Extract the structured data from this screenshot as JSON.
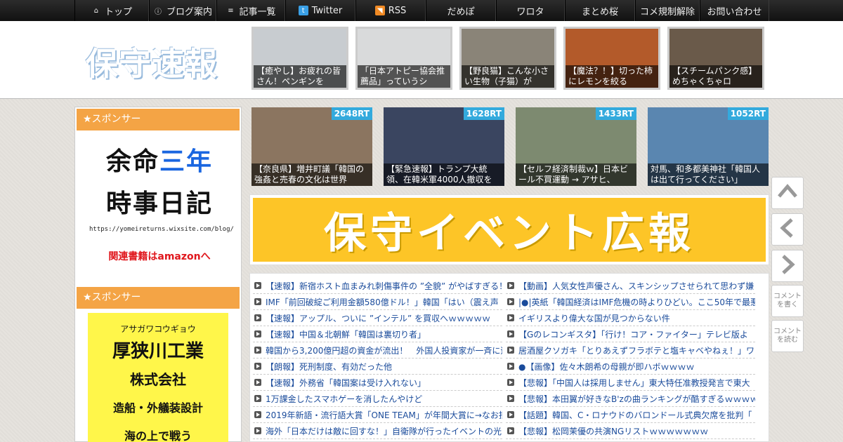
{
  "nav": [
    {
      "icon": "home-icon",
      "label": "トップ",
      "w": 106
    },
    {
      "icon": "info-icon",
      "label": "ブログ案内",
      "w": 96
    },
    {
      "icon": "list-icon",
      "label": "記事一覧",
      "w": 98
    },
    {
      "icon": "twitter-icon",
      "label": "Twitter",
      "w": 100
    },
    {
      "icon": "rss-icon",
      "label": "RSS",
      "w": 100
    },
    {
      "icon": "",
      "label": "だめぽ",
      "w": 100
    },
    {
      "icon": "",
      "label": "ワロタ",
      "w": 98
    },
    {
      "icon": "",
      "label": "まとめ桜",
      "w": 100
    },
    {
      "icon": "",
      "label": "コメ規制解除",
      "w": 92
    },
    {
      "icon": "",
      "label": "お問い合わせ",
      "w": 99
    }
  ],
  "logo": "保守速報",
  "featured": [
    {
      "caption": "【癒やし】お疲れの皆さん！ペンギンを",
      "bg": "#c8ccd0"
    },
    {
      "caption": "「日本アトピー協会推薦品」っていうシ",
      "bg": "#d9dadb"
    },
    {
      "caption": "【野良猫】こんな小さい生物（子猫）が",
      "bg": "#8a8478"
    },
    {
      "caption": "【魔法？！】切った柿にレモンを絞る",
      "bg": "#b35a2a"
    },
    {
      "caption": "【スチームパンク感】めちゃくちゃロ",
      "bg": "#6a5a4a"
    }
  ],
  "sidebar": {
    "heading1": "★スポンサー",
    "heading2": "★スポンサー",
    "ad1": {
      "line1a": "余命",
      "line1b": "三年",
      "line2": "時事日記",
      "url": "https://yomeireturns.wixsite.com/blog/",
      "amazon": "関連書籍はamazonへ"
    },
    "ad2": {
      "kana": "アサガワコウギョウ",
      "name": "厚狭川工業",
      "corp": "株式会社",
      "desc": "造船・外艤装設計",
      "last": "海の上で戦う"
    }
  },
  "rt": [
    {
      "count": "2648RT",
      "caption": "【奈良県】増井町議「韓国の強姦と売春の文化は世界",
      "bg": "#8b7560"
    },
    {
      "count": "1628RT",
      "caption": "【緊急速報】トランプ大統領、在韓米軍4000人撤収を",
      "bg": "#3a4560"
    },
    {
      "count": "1433RT",
      "caption": "【セルフ経済制裁ｗ】日本ビール不買運動 → アサヒ、",
      "bg": "#7d8a70"
    },
    {
      "count": "1052RT",
      "caption": "対馬、和多都美神社「韓国人は出て行ってください」",
      "bg": "#5a86b0"
    }
  ],
  "banner": "保守イベント広報",
  "news_left": [
    "【速報】新宿ホスト血まみれ刺傷事件の ”全貌” がやばすぎる！",
    "IMF「前回破綻ご利用金額580億ドル！」韓国「はい（震え声",
    "【速報】アップル、ついに ”インテル” を買収へｗｗｗｗｗ",
    "【速報】中国＆北朝鮮「韓国は裏切り者」",
    "韓国から3,200億円超の資金が流出！　外国人投資家が一斉に逃",
    "【朗報】死刑制度、有効だった他",
    "【速報】外務省「韓国案は受け入れない」",
    "1万課金したスマホゲーを消したんやけど",
    "2019年新語・流行語大賞「ONE TEAM」が年間大賞に→なお批",
    "海外「日本だけは敵に回すな！」自衛隊が行ったイベントの光"
  ],
  "news_right": [
    "【動画】人気女性声優さん、スキンシップさせられて思わず嫌",
    "|●|英紙「韓国経済はIMF危機の時よりひどい。ここ50年で最悪",
    "イギリスより偉大な国が見つからない件",
    "【Gのレコンギスタ】「行け！コア・ファイター」テレビ版よ",
    "居酒屋クソガキ「とりあえずフラボテと塩キャベやねぇ！」ワ",
    "●【画像】佐々木朗希の母親が即ハボｗｗｗｗ",
    "【悲報】「中国人は採用しません」東大特任准教授発言で東大",
    "【悲報】本田翼が好きなB'zの曲ランキングが酷すぎるｗｗｗｗ",
    "【話題】韓国、C・ロナウドのバロンドール式典欠席を批判「",
    "【悲報】松岡茉優の共演NGリストｗｗｗｗｗｗｗ"
  ],
  "side_buttons": [
    {
      "icon": "arrow-up-icon",
      "label": ""
    },
    {
      "icon": "arrow-left-icon",
      "label": ""
    },
    {
      "icon": "arrow-right-icon",
      "label": ""
    },
    {
      "icon": "",
      "label": "コメントを書く"
    },
    {
      "icon": "",
      "label": "コメントを読む"
    }
  ]
}
